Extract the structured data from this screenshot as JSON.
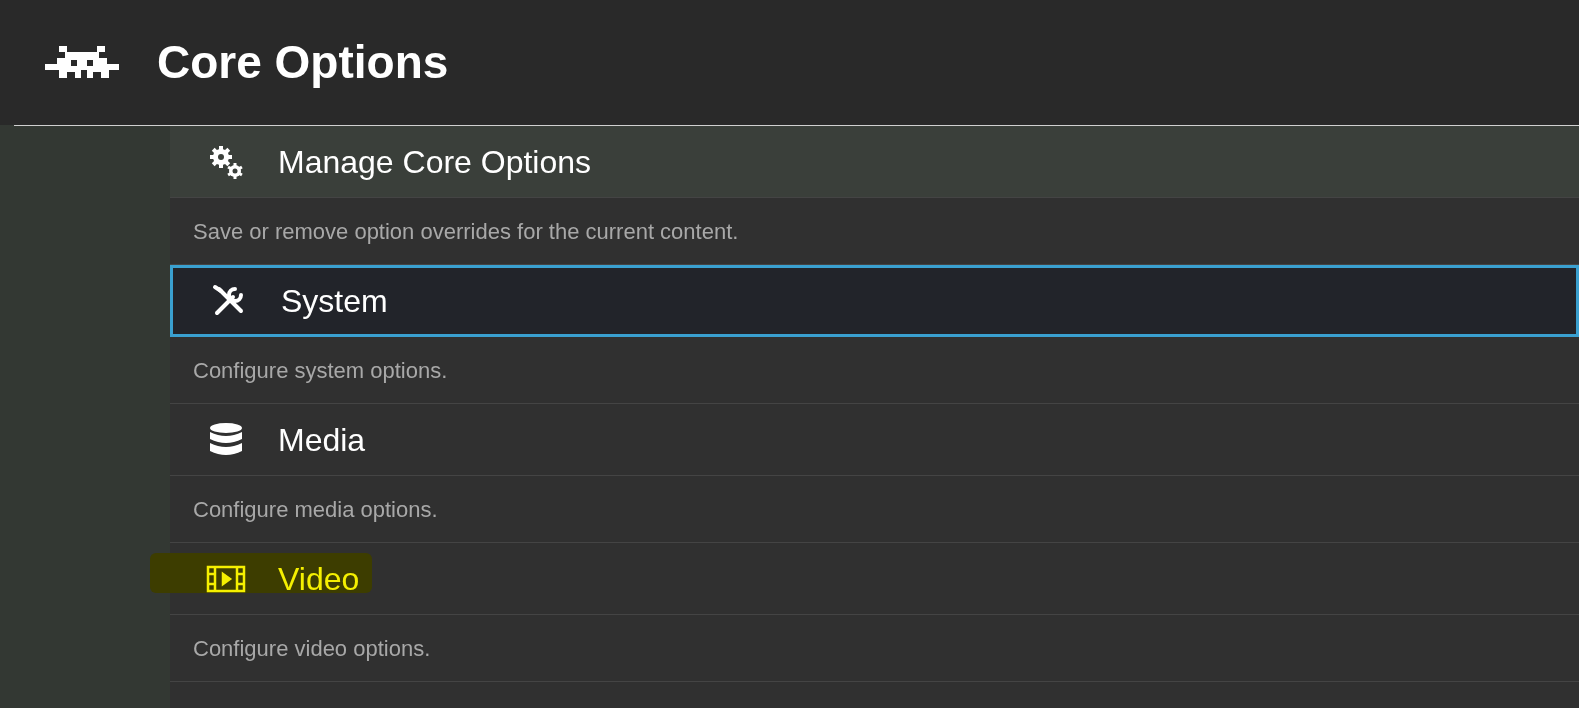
{
  "header": {
    "title": "Core Options"
  },
  "items": [
    {
      "label": "Manage Core Options",
      "description": "Save or remove option overrides for the current content.",
      "selected": false,
      "highlighted": false
    },
    {
      "label": "System",
      "description": "Configure system options.",
      "selected": true,
      "highlighted": false
    },
    {
      "label": "Media",
      "description": "Configure media options.",
      "selected": false,
      "highlighted": false
    },
    {
      "label": "Video",
      "description": "Configure video options.",
      "selected": false,
      "highlighted": true
    }
  ]
}
